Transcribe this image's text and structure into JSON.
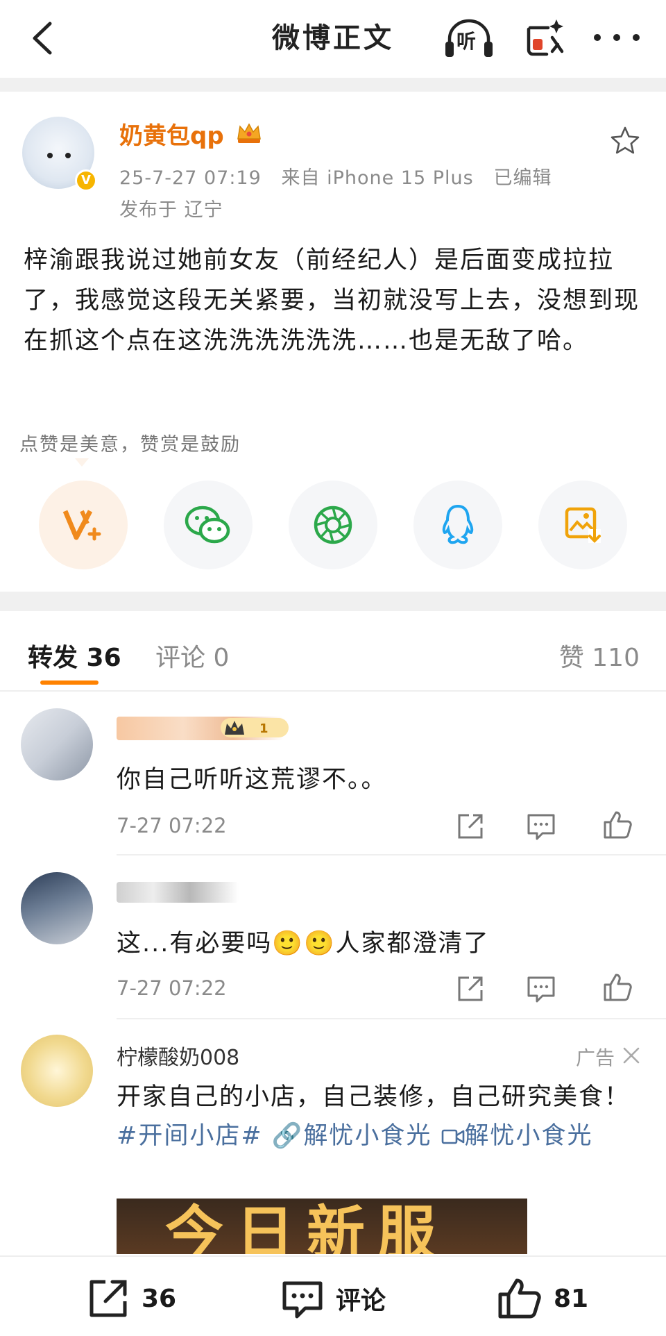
{
  "header": {
    "title": "微博正文",
    "listen_label": "听",
    "back_icon": "back-arrow-icon",
    "ai_icon": "ai-assistant-icon",
    "more_icon": "more-dots-icon"
  },
  "post": {
    "author": "奶黄包qp",
    "time": "25-7-27 07:19",
    "source": "来自 iPhone 15 Plus",
    "edited": "已编辑",
    "location": "发布于 辽宁",
    "content": "梓渝跟我说过她前女友（前经纪人）是后面变成拉拉了，我感觉这段无关紧要，当初就没写上去，没想到现在抓这个点在这洗洗洗洗洗洗……也是无敌了哈。",
    "reward_tip": "点赞是美意，赞赏是鼓励",
    "share_buttons": [
      "reward-icon",
      "wechat-icon",
      "moments-icon",
      "qq-icon",
      "save-image-icon"
    ]
  },
  "tabs": {
    "repost": "转发 36",
    "comment": "评论 0",
    "like": "赞 110"
  },
  "comments": [
    {
      "name": "",
      "text": "你自己听听这荒谬不。。",
      "time": "7-27 07:22"
    },
    {
      "name": "",
      "text": "这...有必要吗🙂🙂人家都澄清了",
      "time": "7-27 07:22"
    }
  ],
  "ad": {
    "name": "柠檬酸奶008",
    "tag": "广告",
    "text_main": "开家自己的小店，自己装修，自己研究美食！",
    "hashtag": "#开间小店#",
    "link1": "🔗解忧小食光",
    "link2": "解忧小食光",
    "image_caption": "今日新服"
  },
  "bottom": {
    "repost_count": "36",
    "comment_label": "评论",
    "like_count": "81"
  },
  "colors": {
    "accent": "#ff8200",
    "username": "#e8710a",
    "link": "#4a6f9e",
    "muted": "#8a8a8a"
  }
}
